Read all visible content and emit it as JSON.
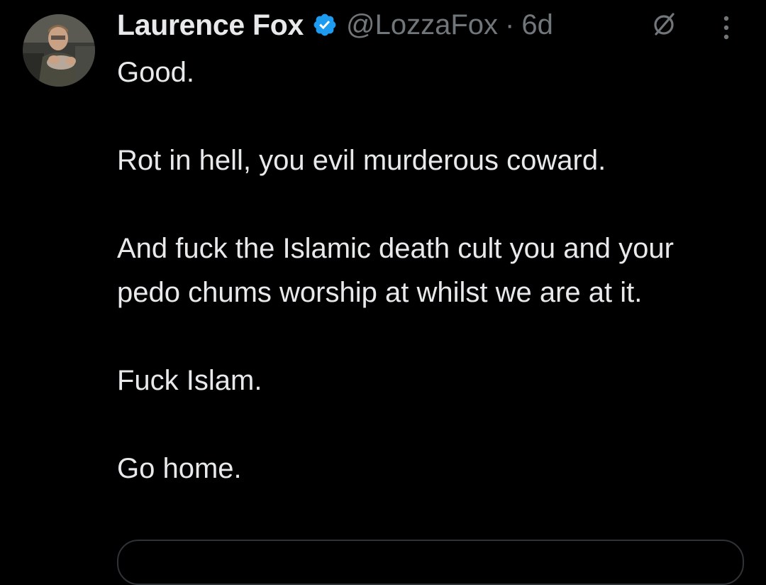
{
  "author": {
    "display_name": "Laurence Fox",
    "handle": "@LozzaFox",
    "separator": "·",
    "time_ago": "6d",
    "verified": true
  },
  "icons": {
    "avatar": "profile-photo",
    "verified": "verified-badge-icon",
    "grok": "grok-icon",
    "more": "more-vertical-icon"
  },
  "tweet": {
    "paragraphs": [
      "Good.",
      "Rot in hell, you evil murderous coward.",
      "And fuck the Islamic death cult you and your pedo chums worship at whilst we are at it.",
      "Fuck Islam.",
      "Go home."
    ]
  },
  "colors": {
    "background": "#000000",
    "primary_text": "#e7e9ea",
    "secondary_text": "#71767b",
    "verified_blue": "#1d9bf0",
    "border": "#2f3336"
  }
}
